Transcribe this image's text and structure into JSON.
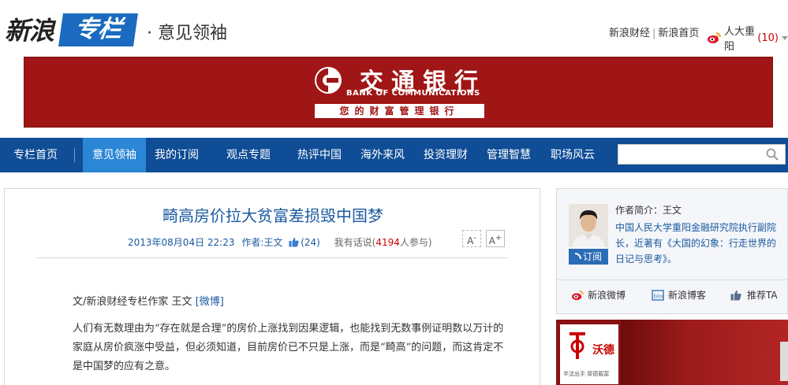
{
  "header": {
    "logo_sina": "新浪",
    "logo_zhuanlan": "专栏",
    "channel": "· 意见领袖",
    "links": [
      "新浪财经",
      "新浪首页"
    ],
    "link_separator": "|",
    "user_name": "人大重阳",
    "user_count": "(10)"
  },
  "banner": {
    "bank_name_cn": "交通银行",
    "bank_name_en": "BANK OF COMMUNICATIONS",
    "slogan": "您的财富管理银行",
    "color": "#a01515"
  },
  "nav": {
    "items": [
      {
        "label": "专栏首页",
        "active": false
      },
      {
        "label": "意见领袖",
        "active": true
      },
      {
        "label": "我的订阅",
        "active": false
      },
      {
        "label": "观点专题",
        "active": false
      },
      {
        "label": "热评中国",
        "active": false
      },
      {
        "label": "海外来风",
        "active": false
      },
      {
        "label": "投资理财",
        "active": false
      },
      {
        "label": "管理智慧",
        "active": false
      },
      {
        "label": "职场风云",
        "active": false
      }
    ],
    "search_placeholder": "",
    "color": "#0f4d96",
    "active_color": "#2b86d6"
  },
  "article": {
    "title": "畸高房价拉大贫富差损毁中国梦",
    "date": "2013年08月04日 22:23",
    "author_label": "作者:王文",
    "likes": "(24)",
    "comment_label": "我有话说(",
    "comment_count": "4194",
    "comment_suffix": "人参与)",
    "font_smaller": "A",
    "font_larger": "A",
    "byline": "文/新浪财经专栏作家 王文 ",
    "byline_weibo": "[微博]",
    "paragraph": "人们有无数理由为“存在就是合理”的房价上涨找到因果逻辑，也能找到无数事例证明数以万计的家庭从房价疯涨中受益，但必须知道，目前房价已不只是上涨，而是“畸高”的问题，而这肯定不是中国梦的应有之意。"
  },
  "sidebar": {
    "author_label": "作者简介：王文",
    "author_desc": "中国人民大学重阳金融研究院执行副院长，近著有《大国的幻象：行走世界的日记与思考》。",
    "subscribe_label": "订阅",
    "share": [
      "新浪微博",
      "新浪博客",
      "推荐TA"
    ],
    "ad_name": "沃德",
    "ad_slogan": "半沈出手 厚德载富"
  }
}
